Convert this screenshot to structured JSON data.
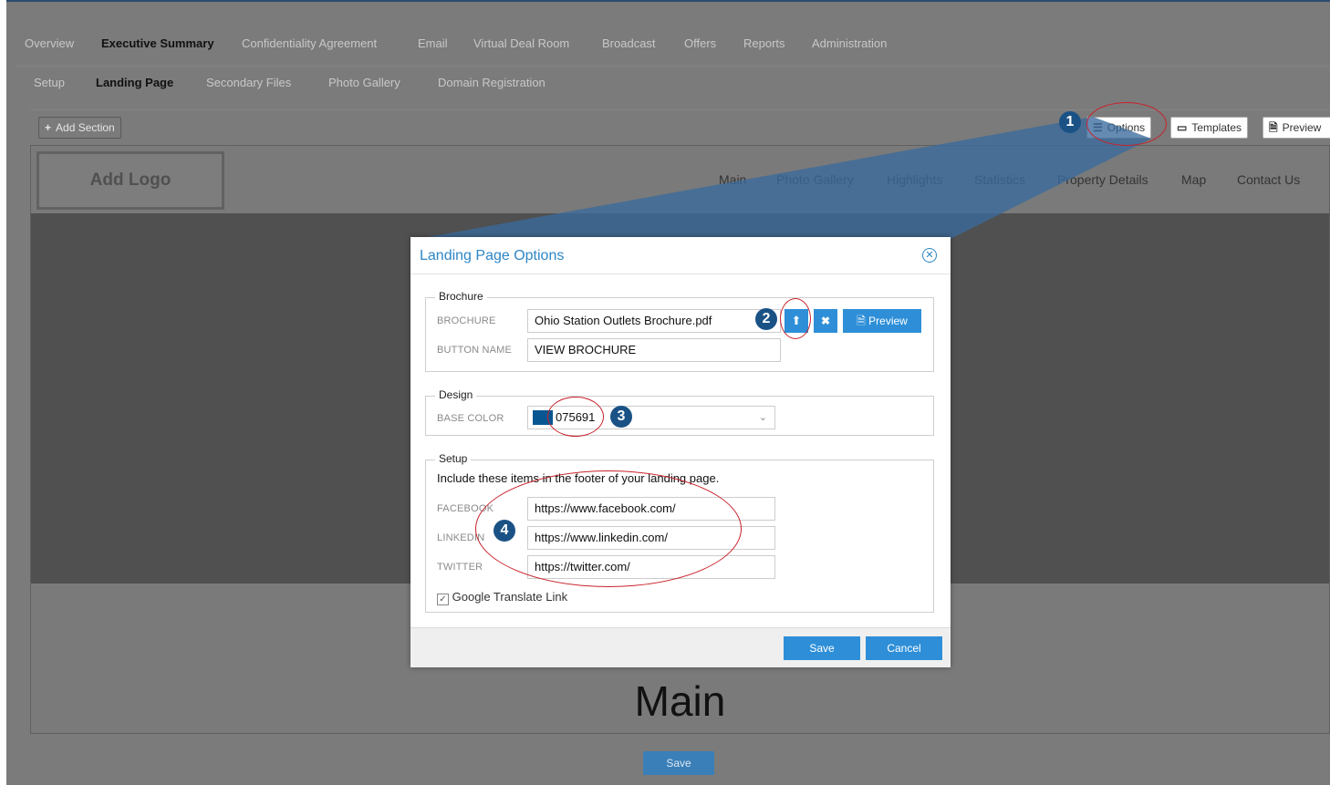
{
  "top_nav": [
    "Overview",
    "Executive Summary",
    "Confidentiality Agreement",
    "Email",
    "Virtual Deal Room",
    "Broadcast",
    "Offers",
    "Reports",
    "Administration"
  ],
  "sub_nav": [
    "Setup",
    "Landing Page",
    "Secondary Files",
    "Photo Gallery",
    "Domain Registration"
  ],
  "toolbar": {
    "add_section": "Add Section",
    "options": "Options",
    "templates": "Templates",
    "preview": "Preview"
  },
  "page": {
    "logo": "Add Logo",
    "nav": [
      "Main",
      "Photo Gallery",
      "Highlights",
      "Statistics",
      "Property Details",
      "Map",
      "Contact Us"
    ],
    "main_heading": "Main",
    "save": "Save"
  },
  "dialog": {
    "title": "Landing Page Options",
    "brochure": {
      "legend": "Brochure",
      "brochure_label": "BROCHURE",
      "brochure_value": "Ohio Station Outlets Brochure.pdf",
      "preview": "Preview",
      "button_name_label": "BUTTON NAME",
      "button_name_value": "VIEW BROCHURE"
    },
    "design": {
      "legend": "Design",
      "base_color_label": "BASE COLOR",
      "base_color_value": "075691",
      "swatch_color": "#075691"
    },
    "setup": {
      "legend": "Setup",
      "description": "Include these items in the footer of your landing page.",
      "facebook_label": "FACEBOOK",
      "facebook_value": "https://www.facebook.com/",
      "linkedin_label": "LINKEDIN",
      "linkedin_value": "https://www.linkedin.com/",
      "twitter_label": "TWITTER",
      "twitter_value": "https://twitter.com/",
      "google_translate": "Google Translate Link",
      "google_translate_checked": true
    },
    "save": "Save",
    "cancel": "Cancel"
  },
  "markers": [
    "1",
    "2",
    "3",
    "4"
  ],
  "colors": {
    "accent": "#2e8fd8",
    "marker": "#1a5286",
    "annotation_ring": "#c9222b"
  }
}
